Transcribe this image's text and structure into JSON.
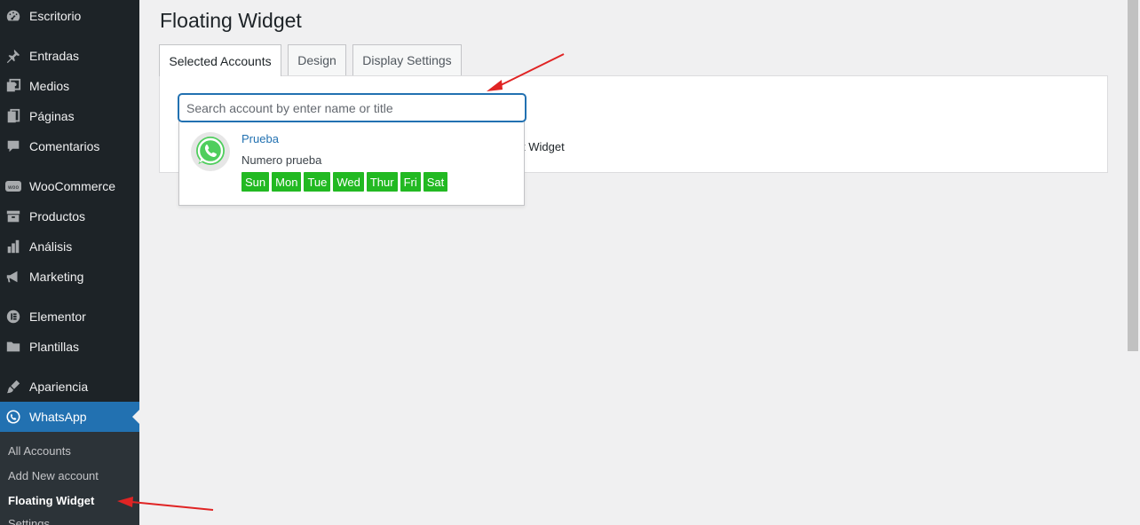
{
  "sidebar": {
    "items": [
      {
        "label": "Escritorio",
        "icon": "dashboard-icon"
      },
      {
        "label": "Entradas",
        "icon": "pin-icon"
      },
      {
        "label": "Medios",
        "icon": "media-icon"
      },
      {
        "label": "Páginas",
        "icon": "pages-icon"
      },
      {
        "label": "Comentarios",
        "icon": "comment-icon"
      },
      {
        "label": "WooCommerce",
        "icon": "woo-icon"
      },
      {
        "label": "Productos",
        "icon": "archive-icon"
      },
      {
        "label": "Análisis",
        "icon": "chart-icon"
      },
      {
        "label": "Marketing",
        "icon": "megaphone-icon"
      },
      {
        "label": "Elementor",
        "icon": "elementor-icon"
      },
      {
        "label": "Plantillas",
        "icon": "folder-icon"
      },
      {
        "label": "Apariencia",
        "icon": "brush-icon"
      },
      {
        "label": "WhatsApp",
        "icon": "whatsapp-icon"
      }
    ],
    "submenu": [
      {
        "label": "All Accounts"
      },
      {
        "label": "Add New account"
      },
      {
        "label": "Floating Widget"
      },
      {
        "label": "Settings"
      }
    ]
  },
  "page": {
    "title": "Floating Widget",
    "tabs": [
      {
        "label": "Selected Accounts"
      },
      {
        "label": "Design"
      },
      {
        "label": "Display Settings"
      }
    ],
    "search": {
      "placeholder": "Search account by enter name or title",
      "value": ""
    },
    "partially_hidden_text": "t Widget",
    "dropdown": {
      "account_name": "Prueba",
      "account_title": "Numero prueba",
      "days": [
        "Sun",
        "Mon",
        "Tue",
        "Wed",
        "Thur",
        "Fri",
        "Sat"
      ],
      "day_color": "#22b922"
    }
  },
  "colors": {
    "sidebar_bg": "#1d2327",
    "accent": "#2271b1",
    "annotation_arrow": "#e02424"
  }
}
